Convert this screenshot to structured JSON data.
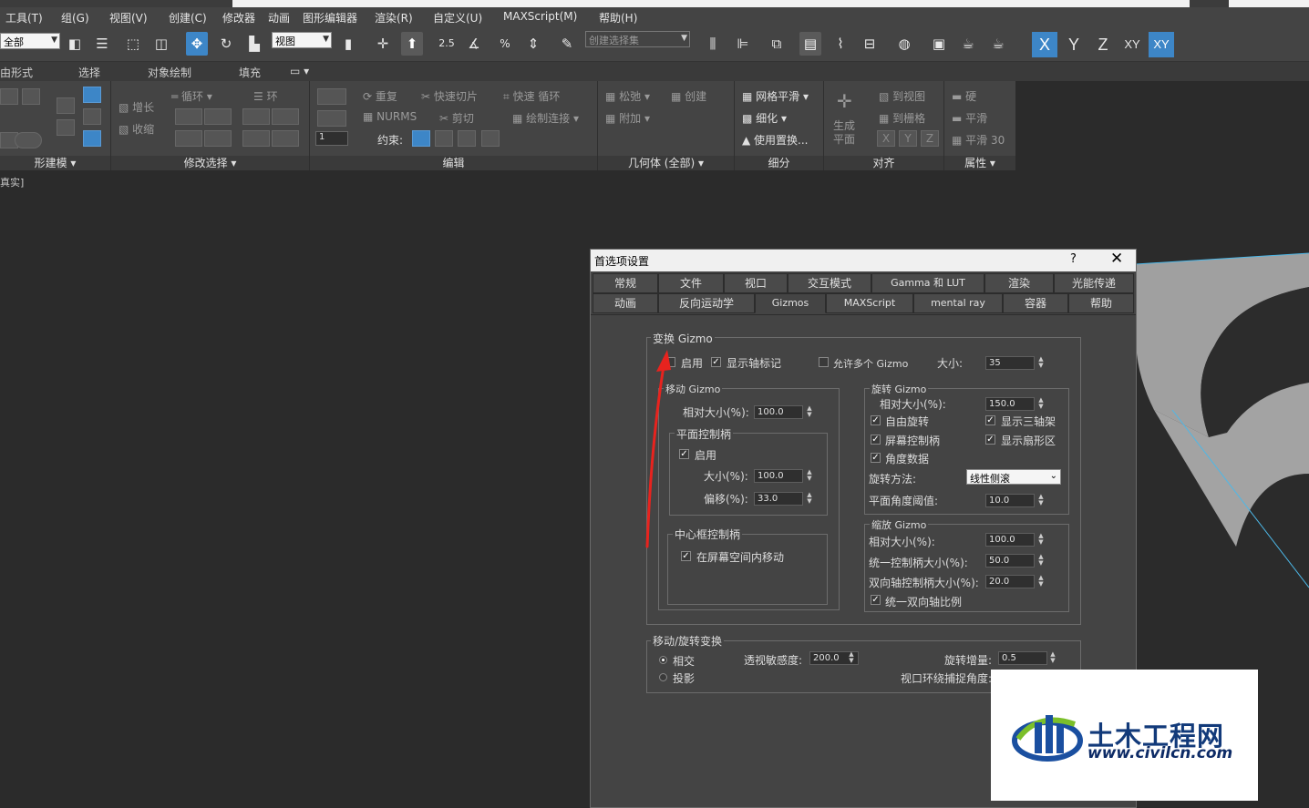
{
  "menubar": {
    "items": [
      "工具(T)",
      "组(G)",
      "视图(V)",
      "创建(C)",
      "修改器",
      "动画",
      "图形编辑器",
      "渲染(R)",
      "自定义(U)",
      "MAXScript(M)",
      "帮助(H)"
    ]
  },
  "toolbar": {
    "filter_value": "全部",
    "view_value": "视图",
    "snap_25": "2.5",
    "selection_set_placeholder": "创建选择集",
    "axes": [
      "X",
      "Y",
      "Z",
      "XY",
      "XY"
    ]
  },
  "ribbon_tabs": [
    "由形式",
    "选择",
    "对象绘制",
    "填充"
  ],
  "ribbon": {
    "groups": {
      "modeling": "形建模",
      "modify_selection": "修改选择",
      "edit": "编辑",
      "geometry": "几何体 (全部)",
      "subdivision": "细分",
      "align": "对齐",
      "properties": "属性"
    },
    "labels": {
      "grow": "增长",
      "shrink": "收缩",
      "loop": "循环",
      "ring": "环",
      "repeat": "重复",
      "quickslice": "快速切片",
      "quickloop": "快速 循环",
      "nurms": "NURMS",
      "cut": "剪切",
      "paint_connect": "绘制连接",
      "constraint": "约束:",
      "relax": "松弛",
      "create": "创建",
      "attach": "附加",
      "meshsmooth": "网格平滑",
      "tessellate": "细化",
      "use_displace": "使用置换...",
      "make_planar": "生成平面",
      "to_view": "到视图",
      "to_grid": "到栅格",
      "axis_x": "X",
      "axis_y": "Y",
      "axis_z": "Z",
      "hard": "硬",
      "smooth": "平滑",
      "smooth30": "平滑 30",
      "spinner_value": "1"
    }
  },
  "viewport": {
    "label": "真实]"
  },
  "dialog": {
    "title": "首选项设置",
    "help": "?",
    "close": "✕",
    "tabs_row1": [
      "常规",
      "文件",
      "视口",
      "交互模式",
      "Gamma 和 LUT",
      "渲染",
      "光能传递"
    ],
    "tabs_row2": [
      "动画",
      "反向运动学",
      "Gizmos",
      "MAXScript",
      "mental ray",
      "容器",
      "帮助"
    ],
    "transform_gizmo": {
      "title": "变换 Gizmo",
      "enable": "启用",
      "show_axis_labels": "显示轴标记",
      "allow_multiple": "允许多个 Gizmo",
      "size_label": "大小:",
      "size_value": "35"
    },
    "move_gizmo": {
      "title": "移动 Gizmo",
      "rel_size_label": "相对大小(%):",
      "rel_size_value": "100.0",
      "plane_handles": {
        "title": "平面控制柄",
        "enable": "启用",
        "size_label": "大小(%):",
        "size_value": "100.0",
        "offset_label": "偏移(%):",
        "offset_value": "33.0"
      },
      "center_box": {
        "title": "中心框控制柄",
        "move_in_screen": "在屏幕空间内移动"
      }
    },
    "rotate_gizmo": {
      "title": "旋转 Gizmo",
      "rel_size_label": "相对大小(%):",
      "rel_size_value": "150.0",
      "free_rotate": "自由旋转",
      "show_tripod": "显示三轴架",
      "screen_handle": "屏幕控制柄",
      "show_sector": "显示扇形区",
      "angle_data": "角度数据",
      "method_label": "旋转方法:",
      "method_value": "线性侧滚",
      "plane_angle_label": "平面角度阈值:",
      "plane_angle_value": "10.0"
    },
    "scale_gizmo": {
      "title": "缩放 Gizmo",
      "rel_size_label": "相对大小(%):",
      "rel_size_value": "100.0",
      "uniform_label": "统一控制柄大小(%):",
      "uniform_value": "50.0",
      "dual_label": "双向轴控制柄大小(%):",
      "dual_value": "20.0",
      "uniform_dual": "统一双向轴比例"
    },
    "move_rotate": {
      "title": "移动/旋转变换",
      "intersect": "相交",
      "project": "投影",
      "sensitivity_label": "透视敏感度:",
      "sensitivity_value": "200.0",
      "rotate_inc_label": "旋转增量:",
      "rotate_inc_value": "0.5",
      "orbit_snap_label": "视口环绕捕捉角度:"
    }
  },
  "watermark": {
    "cn": "土木工程网",
    "url": "www.civilcn.com"
  },
  "colors": {
    "accent": "#3d86c7",
    "arrow": "#e8231e",
    "background": "#2b2b2b"
  }
}
